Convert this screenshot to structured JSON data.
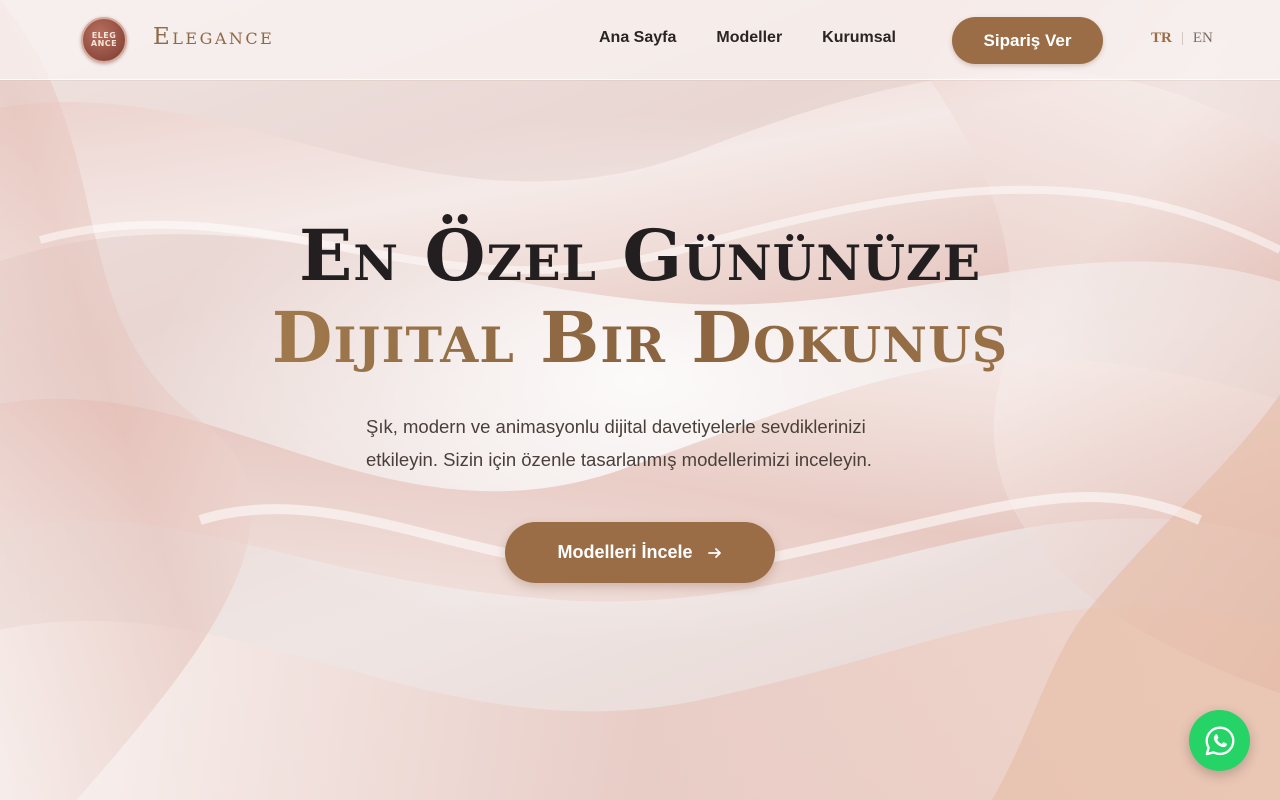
{
  "header": {
    "logo_badge_text": "ELEGANCE",
    "brand_name": "Elegance",
    "nav": [
      {
        "label": "Ana Sayfa"
      },
      {
        "label": "Modeller"
      },
      {
        "label": "Kurumsal"
      }
    ],
    "order_button_label": "Sipariş Ver",
    "languages": {
      "active": "TR",
      "separator": "|",
      "other": "EN"
    }
  },
  "hero": {
    "title_line1": "En Özel Gününüze",
    "title_line2": "Dijital Bir Dokunuş",
    "description": "Şık, modern ve animasyonlu dijital davetiyelerle sevdiklerinizi etkileyin. Sizin için özenle tasarlanmış modellerimizi inceleyin.",
    "cta_label": "Modelleri İncele",
    "cta_icon": "arrow-right-icon"
  },
  "floating": {
    "whatsapp_icon": "whatsapp-icon"
  },
  "colors": {
    "accent": "#9a6d47",
    "title_dark": "#231f20",
    "whatsapp": "#25d366",
    "background": "#f3ecea"
  }
}
